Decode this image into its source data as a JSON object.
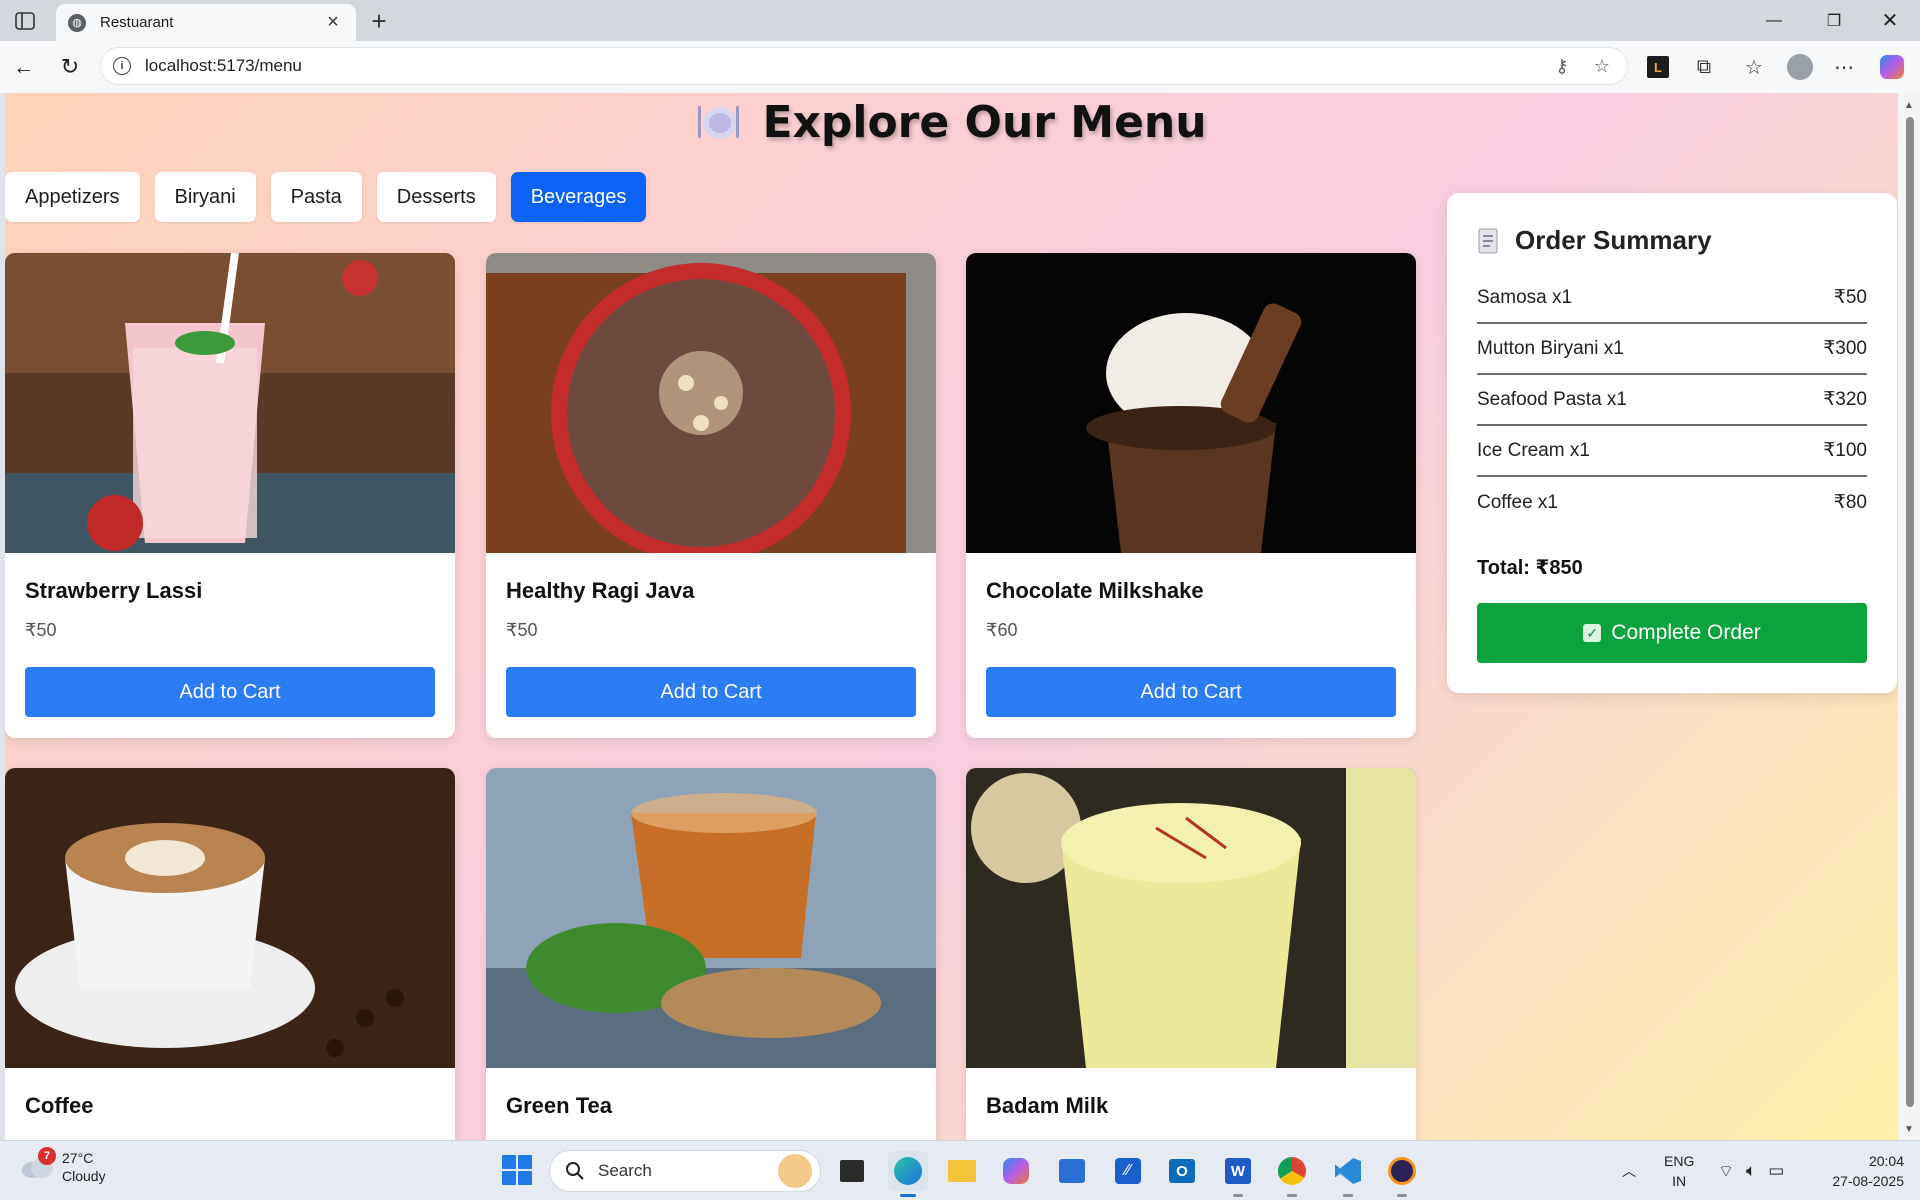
{
  "browser": {
    "tab_title": "Restuarant",
    "url": "localhost:5173/menu"
  },
  "page": {
    "title": "Explore Our Menu",
    "categories": [
      {
        "label": "Appetizers",
        "active": false
      },
      {
        "label": "Biryani",
        "active": false
      },
      {
        "label": "Pasta",
        "active": false
      },
      {
        "label": "Desserts",
        "active": false
      },
      {
        "label": "Beverages",
        "active": true
      }
    ],
    "items": [
      {
        "name": "Strawberry Lassi",
        "price": "₹50",
        "button": "Add to Cart",
        "image": "strawberry-lassi-photo"
      },
      {
        "name": "Healthy Ragi Java",
        "price": "₹50",
        "button": "Add to Cart",
        "image": "ragi-java-photo"
      },
      {
        "name": "Chocolate Milkshake",
        "price": "₹60",
        "button": "Add to Cart",
        "image": "chocolate-milkshake-photo"
      },
      {
        "name": "Coffee",
        "price": "",
        "button": "",
        "image": "coffee-photo"
      },
      {
        "name": "Green Tea",
        "price": "",
        "button": "",
        "image": "green-tea-photo"
      },
      {
        "name": "Badam Milk",
        "price": "",
        "button": "",
        "image": "badam-milk-photo"
      }
    ]
  },
  "order_summary": {
    "title": "Order Summary",
    "rows": [
      {
        "item": "Samosa x1",
        "price": "₹50"
      },
      {
        "item": "Mutton Biryani x1",
        "price": "₹300"
      },
      {
        "item": "Seafood Pasta x1",
        "price": "₹320"
      },
      {
        "item": "Ice Cream x1",
        "price": "₹100"
      },
      {
        "item": "Coffee x1",
        "price": "₹80"
      }
    ],
    "total": "Total: ₹850",
    "complete_button": "Complete Order"
  },
  "taskbar": {
    "weather_temp": "27°C",
    "weather_cond": "Cloudy",
    "weather_badge": "7",
    "search_label": "Search",
    "lang_1": "ENG",
    "lang_2": "IN",
    "time": "20:04",
    "date": "27-08-2025"
  },
  "colors": {
    "accent_blue": "#0b63f6",
    "button_blue": "#2c7cf6",
    "complete_green": "#0aa33d"
  }
}
